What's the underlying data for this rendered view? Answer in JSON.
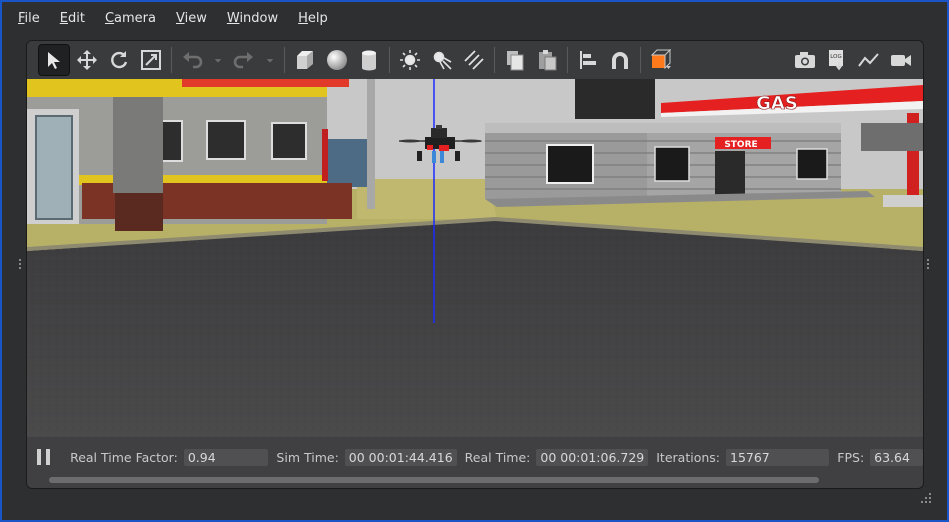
{
  "menu": [
    "File",
    "Edit",
    "Camera",
    "View",
    "Window",
    "Help"
  ],
  "menu_underline": [
    "F",
    "E",
    "C",
    "V",
    "W",
    "H"
  ],
  "menu_rest": [
    "ile",
    "dit",
    "amera",
    "iew",
    "indow",
    "elp"
  ],
  "toolbar": {
    "icons": [
      "select-arrow-icon",
      "translate-icon",
      "rotate-icon",
      "scale-icon",
      "undo-icon",
      "undo-dropdown-icon",
      "redo-icon",
      "redo-dropdown-icon",
      "box-shape-icon",
      "sphere-shape-icon",
      "cylinder-shape-icon",
      "point-light-icon",
      "spot-light-icon",
      "directional-light-icon",
      "copy-icon",
      "paste-icon",
      "align-icon",
      "snap-magnet-icon",
      "view-angle-icon",
      "screenshot-camera-icon",
      "log-icon",
      "plot-icon",
      "video-record-icon"
    ],
    "log_text": "LOG"
  },
  "scene": {
    "sign_gas": "GAS",
    "sign_store": "STORE"
  },
  "status": {
    "real_time_factor_label": "Real Time Factor:",
    "real_time_factor": "0.94",
    "sim_time_label": "Sim Time:",
    "sim_time": "00 00:01:44.416",
    "real_time_label": "Real Time:",
    "real_time": "00 00:01:06.729",
    "iterations_label": "Iterations:",
    "iterations": "15767",
    "fps_label": "FPS:",
    "fps": "63.64"
  },
  "colors": {
    "accent_frame": "#1a55c8",
    "background": "#2e2f31",
    "orange_select": "#ff7a1a",
    "z_axis": "#1a2bff"
  }
}
